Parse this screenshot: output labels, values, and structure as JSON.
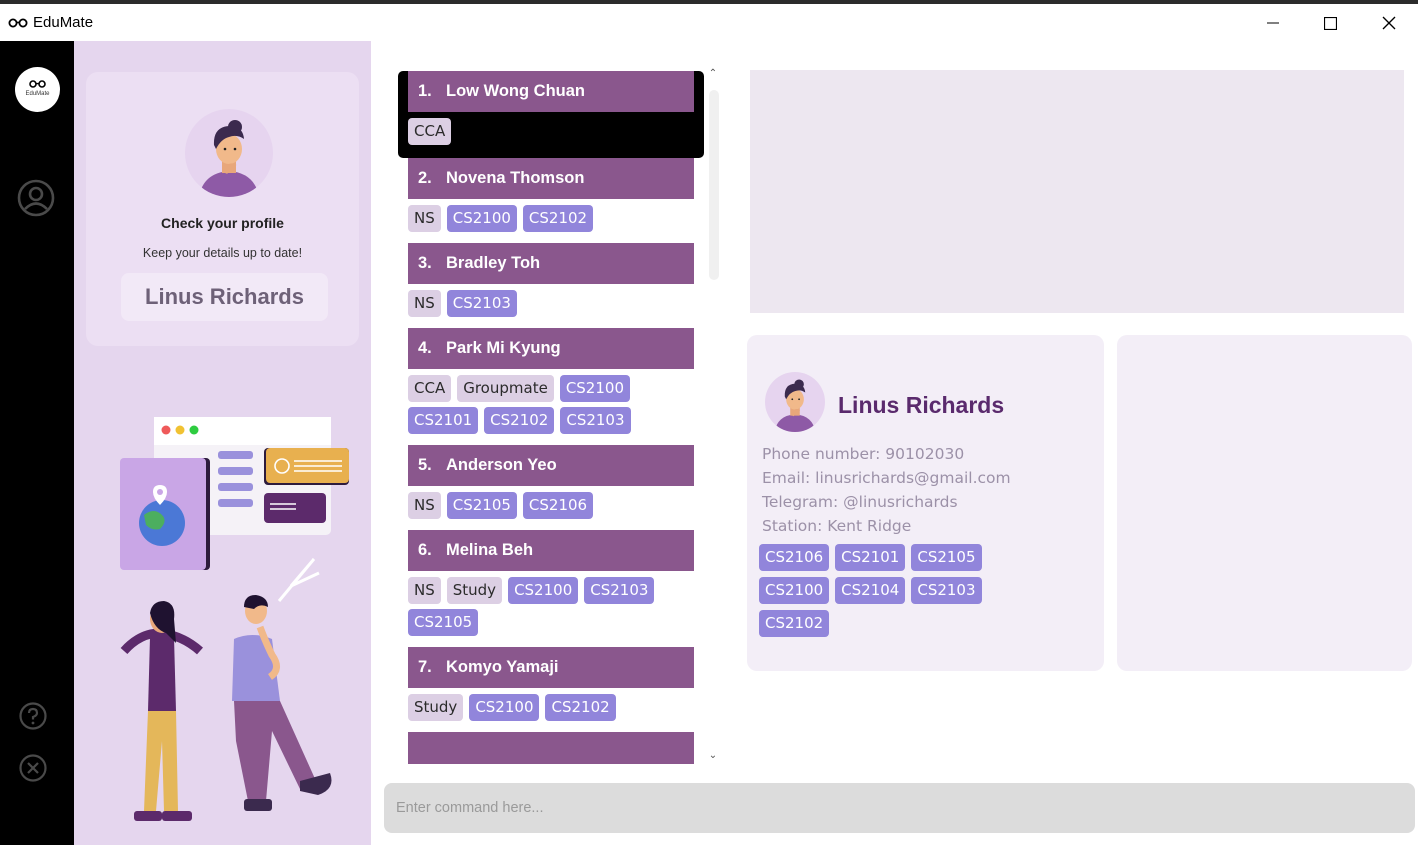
{
  "window": {
    "title": "EduMate"
  },
  "rail": {
    "logo_text": "EduMate"
  },
  "profile": {
    "card_title": "Check your profile",
    "card_subtitle": "Keep your details up to date!",
    "name": "Linus Richards"
  },
  "contacts": [
    {
      "index": "1.",
      "name": "Low Wong Chuan",
      "selected": true,
      "tags": [
        {
          "label": "CCA",
          "kind": "group"
        }
      ]
    },
    {
      "index": "2.",
      "name": "Novena Thomson",
      "tags": [
        {
          "label": "NS",
          "kind": "group"
        },
        {
          "label": "CS2100",
          "kind": "module"
        },
        {
          "label": "CS2102",
          "kind": "module"
        }
      ]
    },
    {
      "index": "3.",
      "name": "Bradley Toh",
      "tags": [
        {
          "label": "NS",
          "kind": "group"
        },
        {
          "label": "CS2103",
          "kind": "module"
        }
      ]
    },
    {
      "index": "4.",
      "name": "Park Mi Kyung",
      "tags": [
        {
          "label": "CCA",
          "kind": "group"
        },
        {
          "label": "Groupmate",
          "kind": "group"
        },
        {
          "label": "CS2100",
          "kind": "module"
        },
        {
          "label": "CS2101",
          "kind": "module"
        },
        {
          "label": "CS2102",
          "kind": "module"
        },
        {
          "label": "CS2103",
          "kind": "module"
        }
      ]
    },
    {
      "index": "5.",
      "name": "Anderson Yeo",
      "tags": [
        {
          "label": "NS",
          "kind": "group"
        },
        {
          "label": "CS2105",
          "kind": "module"
        },
        {
          "label": "CS2106",
          "kind": "module"
        }
      ]
    },
    {
      "index": "6.",
      "name": "Melina Beh",
      "tags": [
        {
          "label": "NS",
          "kind": "group"
        },
        {
          "label": "Study",
          "kind": "group"
        },
        {
          "label": "CS2100",
          "kind": "module"
        },
        {
          "label": "CS2103",
          "kind": "module"
        },
        {
          "label": "CS2105",
          "kind": "module"
        }
      ]
    },
    {
      "index": "7.",
      "name": "Komyo Yamaji",
      "tags": [
        {
          "label": "Study",
          "kind": "group"
        },
        {
          "label": "CS2100",
          "kind": "module"
        },
        {
          "label": "CS2102",
          "kind": "module"
        }
      ]
    },
    {
      "index": "",
      "name": "",
      "tags": []
    }
  ],
  "detail": {
    "name": "Linus Richards",
    "phone": "Phone number: 90102030",
    "email": "Email: linusrichards@gmail.com",
    "telegram": "Telegram: @linusrichards",
    "station": "Station: Kent Ridge",
    "modules": [
      "CS2106",
      "CS2101",
      "CS2105",
      "CS2100",
      "CS2104",
      "CS2103",
      "CS2102"
    ]
  },
  "command": {
    "placeholder": "Enter command here..."
  },
  "colors": {
    "accent": "#8a578d",
    "module_tag": "#9185db",
    "group_tag": "#dccfe4",
    "panel": "#e5d6ee"
  }
}
